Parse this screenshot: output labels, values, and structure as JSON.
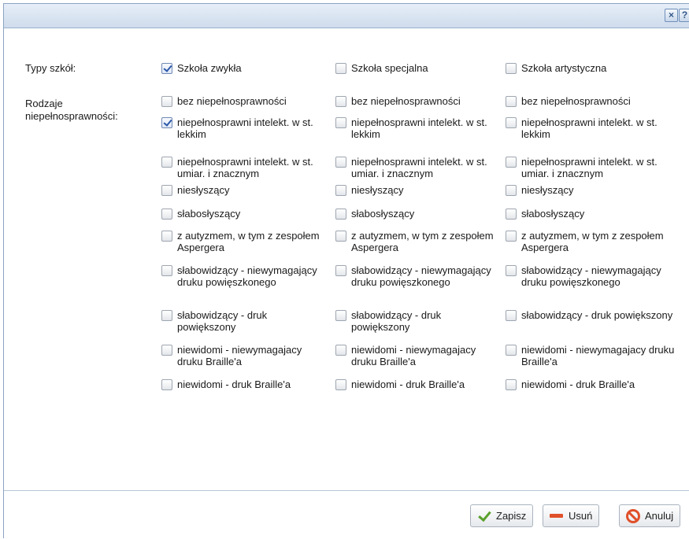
{
  "titlebar": {
    "close_symbol": "×",
    "help_symbol": "?"
  },
  "school_types": {
    "label": "Typy szkół:",
    "options": [
      {
        "label": "Szkoła zwykła",
        "checked": true
      },
      {
        "label": "Szkoła specjalna",
        "checked": false
      },
      {
        "label": "Szkoła artystyczna",
        "checked": false
      }
    ]
  },
  "disabilities": {
    "label": "Rodzaje niepełnosprawności:",
    "columns": [
      {
        "items": [
          {
            "label": "bez niepełnosprawności",
            "checked": false
          },
          {
            "label": "niepełnosprawni intelekt. w st. lekkim",
            "checked": true
          },
          {
            "label": "niepełnosprawni intelekt. w st. umiar. i znacznym",
            "checked": false
          },
          {
            "label": "niesłyszący",
            "checked": false
          },
          {
            "label": "słabosłyszący",
            "checked": false
          },
          {
            "label": "z autyzmem, w tym z zespołem Aspergera",
            "checked": false
          },
          {
            "label": "słabowidzący - niewymagający druku powięszkonego",
            "checked": false
          },
          {
            "label": "słabowidzący - druk powiększony",
            "checked": false
          },
          {
            "label": "niewidomi - niewymagajacy druku Braille'a",
            "checked": false
          },
          {
            "label": "niewidomi - druk Braille'a",
            "checked": false
          }
        ]
      },
      {
        "items": [
          {
            "label": "bez niepełnosprawności",
            "checked": false
          },
          {
            "label": "niepełnosprawni intelekt. w st. lekkim",
            "checked": false
          },
          {
            "label": "niepełnosprawni intelekt. w st. umiar. i znacznym",
            "checked": false
          },
          {
            "label": "niesłyszący",
            "checked": false
          },
          {
            "label": "słabosłyszący",
            "checked": false
          },
          {
            "label": "z autyzmem, w tym z zespołem Aspergera",
            "checked": false
          },
          {
            "label": "słabowidzący - niewymagający druku powięszkonego",
            "checked": false
          },
          {
            "label": "słabowidzący - druk powiększony",
            "checked": false
          },
          {
            "label": "niewidomi - niewymagajacy druku Braille'a",
            "checked": false
          },
          {
            "label": "niewidomi - druk Braille'a",
            "checked": false
          }
        ]
      },
      {
        "items": [
          {
            "label": "bez niepełnosprawności",
            "checked": false
          },
          {
            "label": "niepełnosprawni intelekt. w st. lekkim",
            "checked": false
          },
          {
            "label": "niepełnosprawni intelekt. w st. umiar. i znacznym",
            "checked": false
          },
          {
            "label": "niesłyszący",
            "checked": false
          },
          {
            "label": "słabosłyszący",
            "checked": false
          },
          {
            "label": "z autyzmem, w tym z zespołem Aspergera",
            "checked": false
          },
          {
            "label": "słabowidzący - niewymagający druku powięszkonego",
            "checked": false
          },
          {
            "label": "słabowidzący - druk powiększony",
            "checked": false
          },
          {
            "label": "niewidomi - niewymagajacy druku Braille'a",
            "checked": false
          },
          {
            "label": "niewidomi - druk Braille'a",
            "checked": false
          }
        ]
      }
    ]
  },
  "footer": {
    "save_label": "Zapisz",
    "delete_label": "Usuń",
    "cancel_label": "Anuluj",
    "save_icon": "check-icon",
    "delete_icon": "minus-icon",
    "cancel_icon": "cancel-icon"
  },
  "colors": {
    "titlebar": "#cfdcec",
    "border": "#8aa3c2",
    "save_icon": "#5aa02c",
    "delete_icon": "#e0502a"
  }
}
